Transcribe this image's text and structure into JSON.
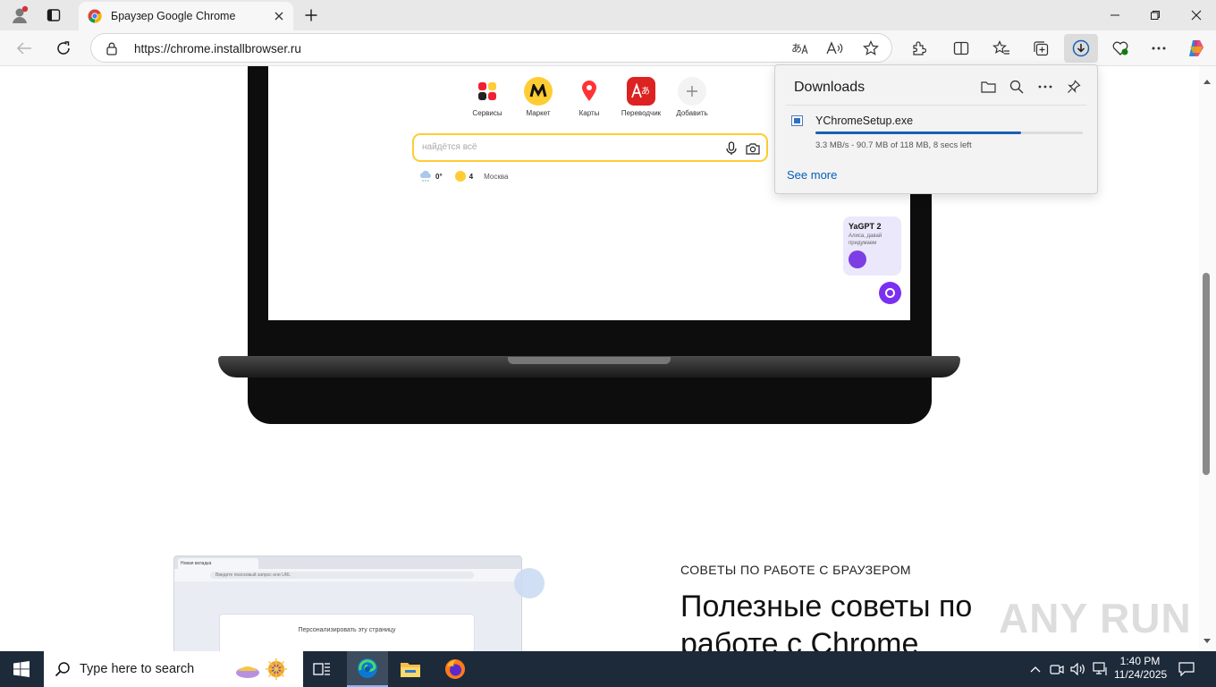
{
  "colors": {
    "accent": "#005fb8",
    "progress": "#1a5fb4",
    "taskbar": "#1c2a3a"
  },
  "tab": {
    "title": "Браузер Google Chrome"
  },
  "address": {
    "url": "https://chrome.installbrowser.ru"
  },
  "laptop_screen": {
    "services": [
      {
        "label": "Сервисы",
        "icon": "grid-apps-icon"
      },
      {
        "label": "Маркет",
        "icon": "market-icon"
      },
      {
        "label": "Карты",
        "icon": "map-pin-icon"
      },
      {
        "label": "Переводчик",
        "icon": "translate-icon"
      },
      {
        "label": "Добавить",
        "icon": "plus-icon"
      }
    ],
    "search_placeholder": "найдётся всё",
    "weather": "0°",
    "traffic": "4",
    "city": "Москва",
    "gpt_title": "YaGPT 2",
    "gpt_sub": "Алиса, давай придумаем"
  },
  "downloads": {
    "header": "Downloads",
    "file_name": "YChromeSetup.exe",
    "status": "3.3 MB/s - 90.7 MB of 118 MB, 8 secs left",
    "progress_fraction": 0.77,
    "see_more": "See more"
  },
  "mini_browser": {
    "tab": "Новая вкладка",
    "address_placeholder": "Введите поисковый запрос или URL",
    "customize": "Персонализировать эту страницу"
  },
  "tips": {
    "kicker": "СОВЕТЫ ПО РАБОТЕ С БРАУЗЕРОМ",
    "title": "Полезные советы по работе с Chrome"
  },
  "watermark": "ANY RUN",
  "taskbar": {
    "search_placeholder": "Type here to search",
    "time": "1:40 PM",
    "date": "11/24/2025"
  }
}
